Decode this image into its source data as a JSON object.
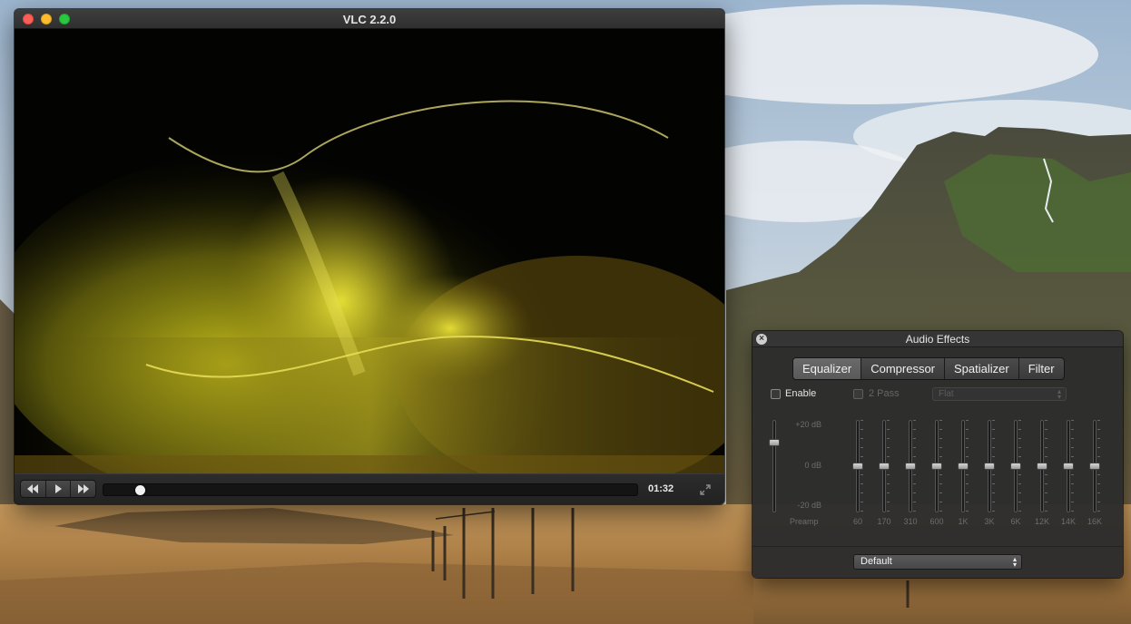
{
  "vlc": {
    "title": "VLC 2.2.0",
    "controls": {
      "rewind_icon": "rewind-icon",
      "play_icon": "play-icon",
      "forward_icon": "fast-forward-icon"
    },
    "time": "01:32",
    "seek_position": 0.06,
    "fullscreen_icon": "fullscreen-icon"
  },
  "audio_effects": {
    "title": "Audio Effects",
    "tabs": [
      {
        "label": "Equalizer",
        "active": true
      },
      {
        "label": "Compressor",
        "active": false
      },
      {
        "label": "Spatializer",
        "active": false
      },
      {
        "label": "Filter",
        "active": false
      }
    ],
    "enable_label": "Enable",
    "two_pass_label": "2 Pass",
    "preset": "Flat",
    "db_labels": {
      "top": "+20 dB",
      "mid": "0 dB",
      "bottom": "-20 dB"
    },
    "preamp": {
      "label": "Preamp",
      "level": 0.78
    },
    "bands": [
      {
        "label": "60",
        "level": 0.5
      },
      {
        "label": "170",
        "level": 0.5
      },
      {
        "label": "310",
        "level": 0.5
      },
      {
        "label": "600",
        "level": 0.5
      },
      {
        "label": "1K",
        "level": 0.5
      },
      {
        "label": "3K",
        "level": 0.5
      },
      {
        "label": "6K",
        "level": 0.5
      },
      {
        "label": "12K",
        "level": 0.5
      },
      {
        "label": "14K",
        "level": 0.5
      },
      {
        "label": "16K",
        "level": 0.5
      }
    ],
    "profile": "Default"
  }
}
